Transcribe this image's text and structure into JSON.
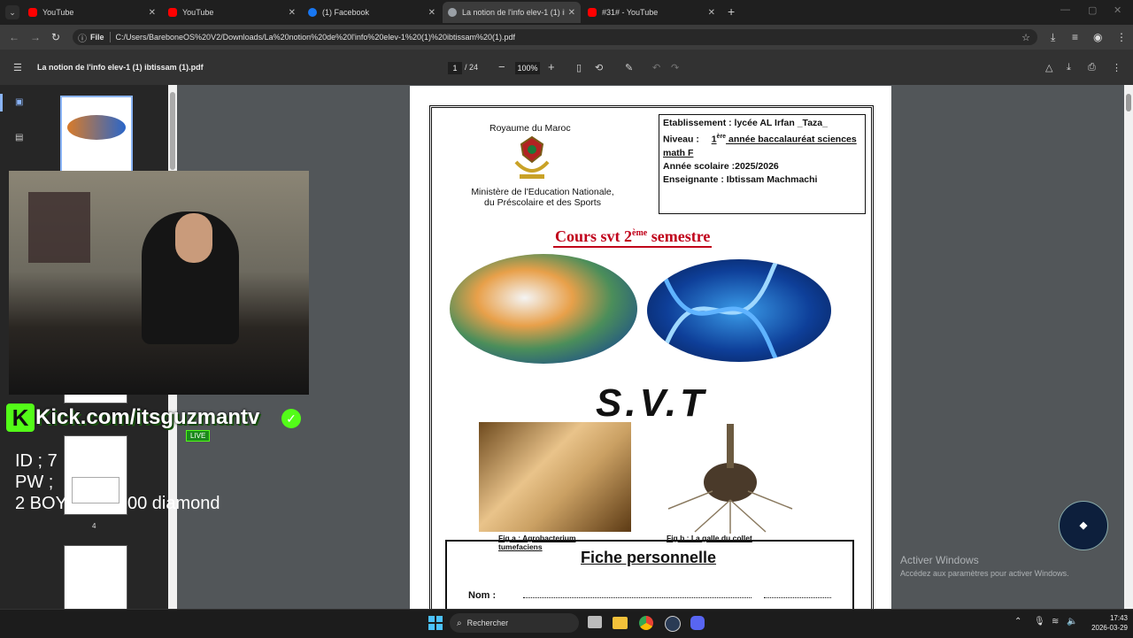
{
  "browser": {
    "tabs": [
      {
        "title": "YouTube",
        "favicon": "youtube-icon",
        "color": "#ff0000"
      },
      {
        "title": "YouTube",
        "favicon": "youtube-icon",
        "color": "#ff0000"
      },
      {
        "title": "(1) Facebook",
        "favicon": "facebook-icon",
        "color": "#1877f2"
      },
      {
        "title": "La notion de l'info elev-1 (1) ib",
        "favicon": "pdf-icon",
        "color": "#9aa0a6",
        "active": true
      },
      {
        "title": "#31# - YouTube",
        "favicon": "youtube-icon",
        "color": "#ff0000"
      }
    ],
    "address": {
      "scheme_label": "File",
      "url": "C:/Users/BareboneOS%20V2/Downloads/La%20notion%20de%20l'info%20elev-1%20(1)%20ibtissam%20(1).pdf"
    }
  },
  "pdf": {
    "filename": "La notion de l'info elev-1 (1) ibtissam (1).pdf",
    "current_page": "1",
    "total_pages": "/ 24",
    "zoom": "100%",
    "sidebar_page_label": "4"
  },
  "document": {
    "kingdom": "Royaume du Maroc",
    "ministry_line1": "Ministère de l'Education Nationale,",
    "ministry_line2": "du Préscolaire et des Sports",
    "info": {
      "etablissement": "Etablissement : lycée AL Irfan _Taza_",
      "niveau_label": "Niveau :",
      "niveau_num": "1",
      "niveau_sup": "ère",
      "niveau_rest": " année baccalauréat sciences math F",
      "annee": "Année scolaire :2025/2026",
      "enseignante": "Enseignante : Ibtissam Machmachi"
    },
    "cours_pre": "Cours svt 2",
    "cours_sup": "ème",
    "cours_post": " semestre",
    "svt_title": "S.V.T",
    "fig_a": "Fig a : Agrobacterium tumefaciens",
    "fig_b": "Fig b : La galle du collet",
    "fiche_title": "Fiche personnelle",
    "nom_label": "Nom :"
  },
  "overlay": {
    "kick_text": "Kick.com/itsguzmantv",
    "live_badge": "LIVE",
    "id_line": "ID ; 7",
    "pw_line": "PW ;",
    "boy_line": "2 BOY",
    "diamond_line": "00 diamond",
    "watermark_line1": "Activer Windows",
    "watermark_line2": "Accédez aux paramètres pour activer Windows."
  },
  "taskbar": {
    "search_placeholder": "Rechercher",
    "time": "17:43",
    "date": "2026-03-29"
  }
}
